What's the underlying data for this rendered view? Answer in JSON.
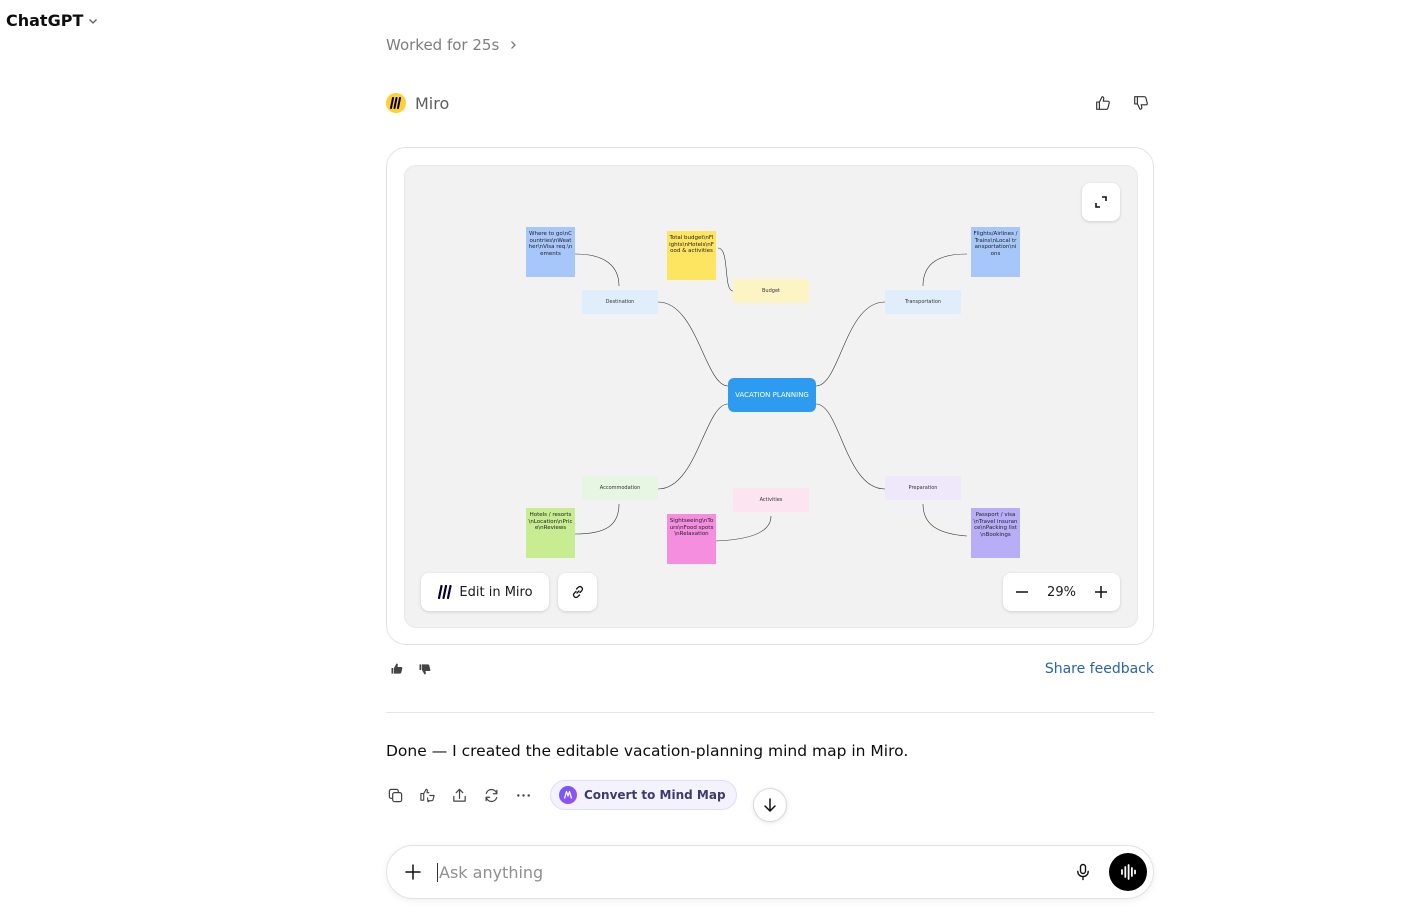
{
  "header": {
    "title": "ChatGPT"
  },
  "worked": {
    "label": "Worked for 25s"
  },
  "tool": {
    "name": "Miro"
  },
  "board": {
    "center": "VACATION PLANNING",
    "branches": {
      "destination": "Destination",
      "budget": "Budget",
      "transportation": "Transportation",
      "accommodation": "Accommodation",
      "activities": "Activities",
      "preparation": "Preparation"
    },
    "stickies": {
      "destination": "Where to go\\nCountries\\nWeather\\nVisa req.\\nements",
      "budget": "Total budget\\nFlights\\nHotels\\nFood & activities",
      "transportation": "Flights/Airlines / Trains\\nLocal transportation\\nions",
      "accommodation": "Hotels / resorts\\nLocation\\nPrice\\nReviews",
      "activities": "Sightseeing\\nTours\\nFood spots\\nRelaxation",
      "preparation": "Passport / visa\\nTravel insurance\\nPacking list\\nBookings"
    },
    "colors": {
      "center": "#2d9bf0",
      "sticky_blue": "#a7c7fa",
      "sticky_yellow": "#fde562",
      "sticky_green": "#c7ec91",
      "sticky_pink": "#f68ee0",
      "sticky_purple": "#b8aef7"
    },
    "edit_label": "Edit in Miro",
    "zoom": "29%"
  },
  "feedback": {
    "share_label": "Share feedback"
  },
  "message": {
    "text": "Done — I created the editable vacation-planning mind map in Miro."
  },
  "actions": {
    "convert_label": "Convert to Mind Map"
  },
  "composer": {
    "placeholder": "Ask anything"
  }
}
